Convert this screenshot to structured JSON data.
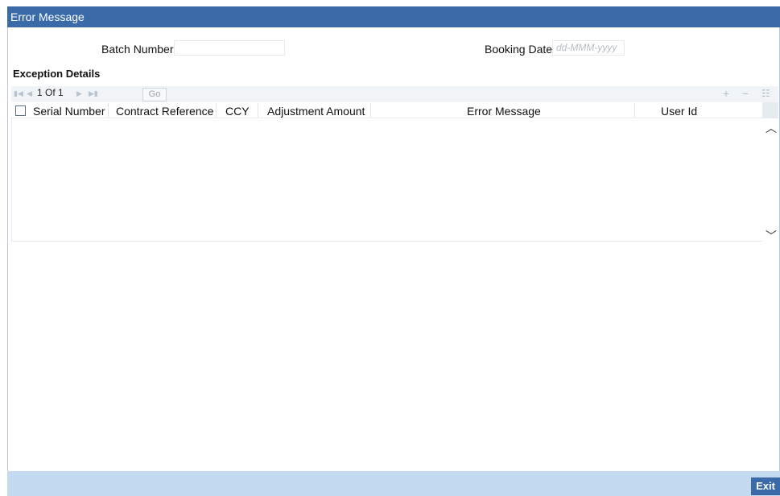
{
  "window": {
    "title": "Error Message"
  },
  "form": {
    "batch_number_label": "Batch Number",
    "batch_number_value": "",
    "booking_date_label": "Booking Date",
    "booking_date_placeholder": "dd-MMM-yyyy"
  },
  "section": {
    "title": "Exception Details"
  },
  "toolbar": {
    "page_info": "1 Of 1",
    "go_label": "Go",
    "icons": [
      "first-page-icon",
      "previous-page-icon",
      "next-page-icon",
      "last-page-icon",
      "add-row-icon",
      "delete-row-icon",
      "single-view-icon"
    ]
  },
  "table": {
    "columns": [
      "Serial Number",
      "Contract Reference",
      "CCY",
      "Adjustment Amount",
      "Error Message",
      "User Id"
    ],
    "rows": []
  },
  "footer": {
    "exit_label": "Exit"
  },
  "colors": {
    "title_bar": "#3a6aa8",
    "footer": "#c4daf0",
    "exit_button": "#3a6aa8"
  }
}
